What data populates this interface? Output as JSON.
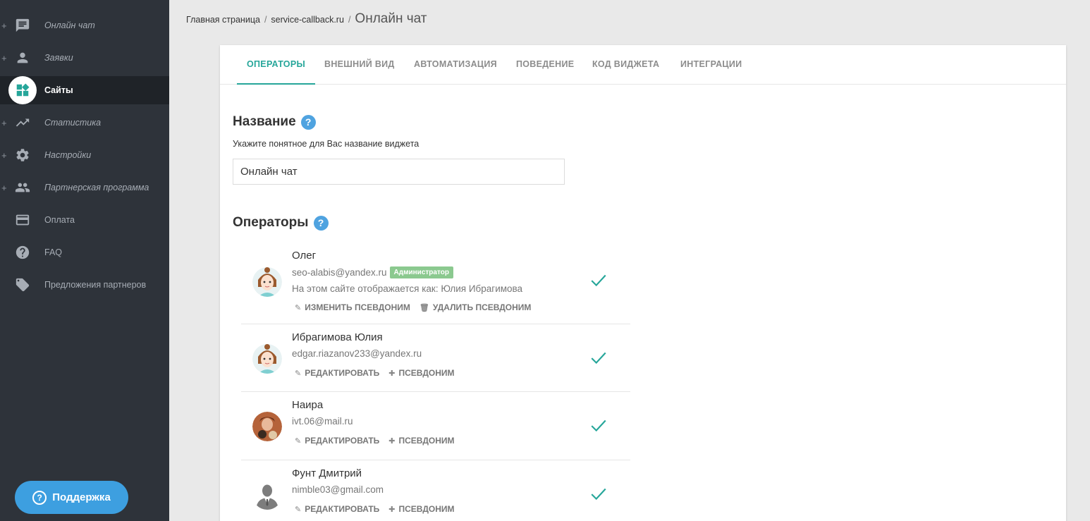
{
  "sidebar": {
    "items": [
      {
        "label": "Онлайн чат",
        "icon": "chat-icon",
        "plus": "+"
      },
      {
        "label": "Заявки",
        "icon": "person-icon",
        "plus": "+"
      },
      {
        "label": "Сайты",
        "icon": "widgets-icon",
        "plus": ""
      },
      {
        "label": "Статистика",
        "icon": "trending-up-icon",
        "plus": "+"
      },
      {
        "label": "Настройки",
        "icon": "gear-icon",
        "plus": "+"
      },
      {
        "label": "Партнерская программа",
        "icon": "people-icon",
        "plus": "+"
      },
      {
        "label": "Оплата",
        "icon": "credit-card-icon",
        "plus": ""
      },
      {
        "label": "FAQ",
        "icon": "help-icon",
        "plus": ""
      },
      {
        "label": "Предложения партнеров",
        "icon": "tag-icon",
        "plus": ""
      }
    ],
    "support_label": "Поддержка"
  },
  "breadcrumb": {
    "home": "Главная страница",
    "site": "service-callback.ru",
    "current": "Онлайн чат",
    "separator": "/"
  },
  "tabs": [
    "ОПЕРАТОРЫ",
    "ВНЕШНИЙ ВИД",
    "АВТОМАТИЗАЦИЯ",
    "ПОВЕДЕНИЕ",
    "КОД ВИДЖЕТА",
    "ИНТЕГРАЦИИ"
  ],
  "name_section": {
    "title": "Название",
    "help": "?",
    "hint": "Укажите понятное для Вас название виджета",
    "value": "Онлайн чат"
  },
  "operators_section": {
    "title": "Операторы",
    "help": "?"
  },
  "operators": [
    {
      "name": "Олег",
      "email": "seo-alabis@yandex.ru",
      "badge": "Администратор",
      "alias": "На этом сайте отображается как: Юлия Ибрагимова",
      "action1": "ИЗМЕНИТЬ ПСЕВДОНИМ",
      "action2": "УДАЛИТЬ ПСЕВДОНИМ"
    },
    {
      "name": "Ибрагимова Юлия",
      "email": "edgar.riazanov233@yandex.ru",
      "action1": "РЕДАКТИРОВАТЬ",
      "action2": "ПСЕВДОНИМ"
    },
    {
      "name": "Наира",
      "email": "ivt.06@mail.ru",
      "action1": "РЕДАКТИРОВАТЬ",
      "action2": "ПСЕВДОНИМ"
    },
    {
      "name": "Фунт Дмитрий",
      "email": "nimble03@gmail.com",
      "action1": "РЕДАКТИРОВАТЬ",
      "action2": "ПСЕВДОНИМ"
    }
  ],
  "colors": {
    "accent": "#26a69a",
    "sidebar_bg": "#2e333a",
    "support_btn": "#3d9fe0",
    "badge": "#8bc98f"
  }
}
